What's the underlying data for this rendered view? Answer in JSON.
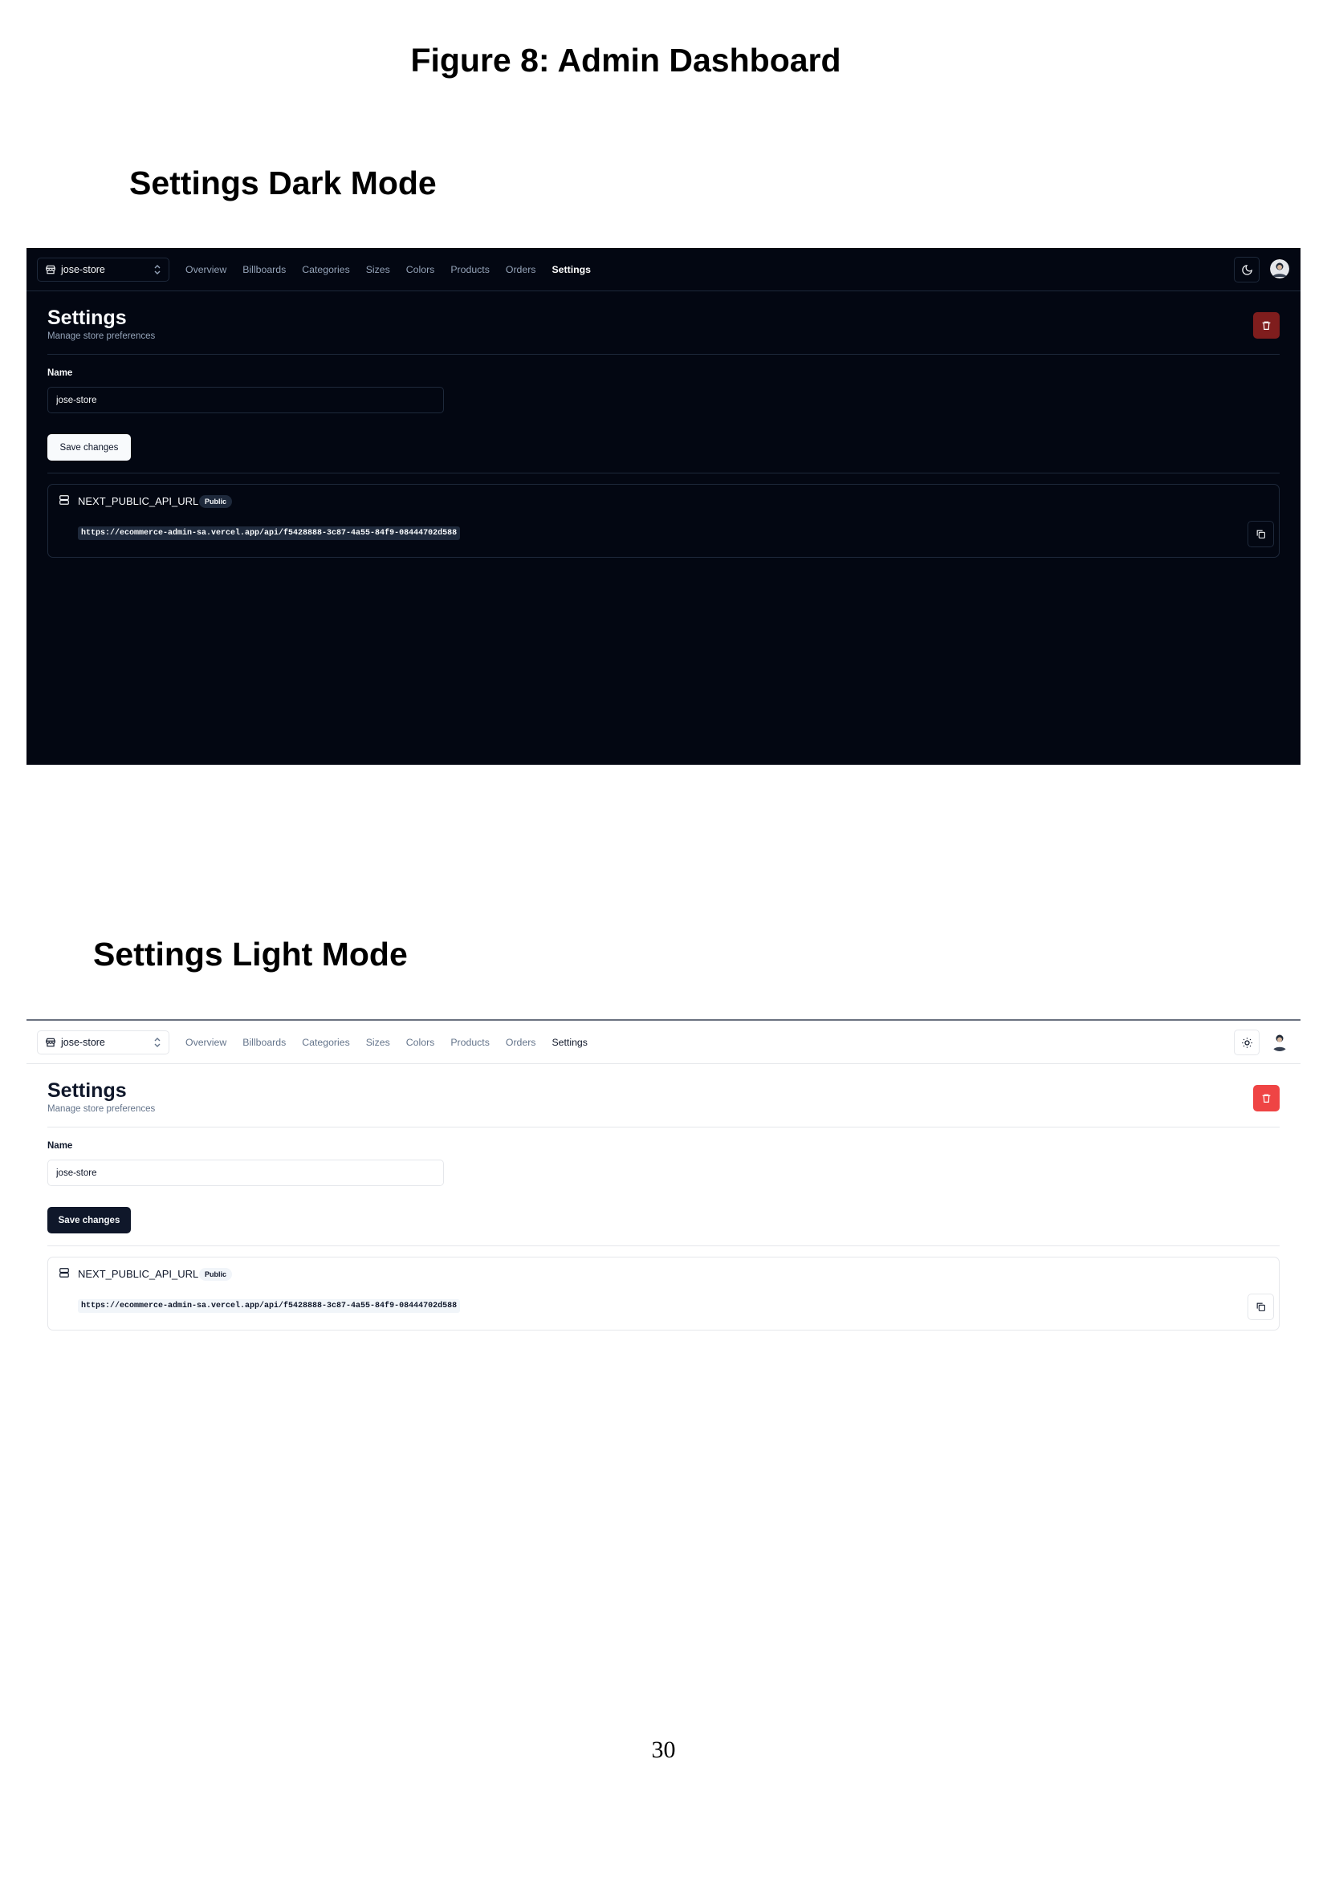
{
  "figure_title": "Figure 8: Admin Dashboard",
  "page_number": "30",
  "dark": {
    "heading": "Settings Dark Mode",
    "store_switcher": {
      "label": "jose-store"
    },
    "nav": [
      "Overview",
      "Billboards",
      "Categories",
      "Sizes",
      "Colors",
      "Products",
      "Orders",
      "Settings"
    ],
    "active_nav": "Settings",
    "theme_icon": "moon-icon",
    "page": {
      "title": "Settings",
      "subtitle": "Manage store preferences"
    },
    "form": {
      "name_label": "Name",
      "name_value": "jose-store",
      "save_label": "Save changes"
    },
    "api": {
      "name": "NEXT_PUBLIC_API_URL",
      "badge": "Public",
      "url": "https://ecommerce-admin-sa.vercel.app/api/f5428888-3c87-4a55-84f9-08444702d588"
    },
    "colors": {
      "background": "#030712",
      "delete_button": "#7f1d1d"
    }
  },
  "light": {
    "heading": "Settings Light Mode",
    "store_switcher": {
      "label": "jose-store"
    },
    "nav": [
      "Overview",
      "Billboards",
      "Categories",
      "Sizes",
      "Colors",
      "Products",
      "Orders",
      "Settings"
    ],
    "active_nav": "Settings",
    "theme_icon": "sun-icon",
    "page": {
      "title": "Settings",
      "subtitle": "Manage store preferences"
    },
    "form": {
      "name_label": "Name",
      "name_value": "jose-store",
      "save_label": "Save changes"
    },
    "api": {
      "name": "NEXT_PUBLIC_API_URL",
      "badge": "Public",
      "url": "https://ecommerce-admin-sa.vercel.app/api/f5428888-3c87-4a55-84f9-08444702d588"
    },
    "colors": {
      "background": "#ffffff",
      "delete_button": "#ef4444"
    }
  }
}
